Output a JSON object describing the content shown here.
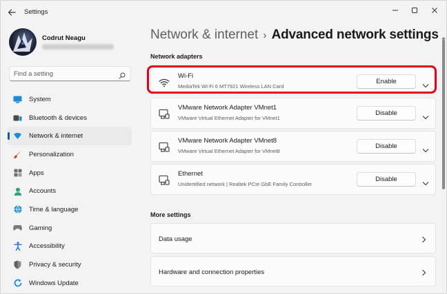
{
  "window": {
    "title": "Settings",
    "controls": [
      "minimize",
      "maximize",
      "close"
    ]
  },
  "profile": {
    "name": "Codrut Neagu"
  },
  "search": {
    "placeholder": "Find a setting"
  },
  "sidebar": {
    "items": [
      {
        "label": "System",
        "icon": "system-icon",
        "active": false
      },
      {
        "label": "Bluetooth & devices",
        "icon": "bluetooth-icon",
        "active": false
      },
      {
        "label": "Network & internet",
        "icon": "network-icon",
        "active": true
      },
      {
        "label": "Personalization",
        "icon": "brush-icon",
        "active": false
      },
      {
        "label": "Apps",
        "icon": "apps-icon",
        "active": false
      },
      {
        "label": "Accounts",
        "icon": "account-icon",
        "active": false
      },
      {
        "label": "Time & language",
        "icon": "globe-icon",
        "active": false
      },
      {
        "label": "Gaming",
        "icon": "gamepad-icon",
        "active": false
      },
      {
        "label": "Accessibility",
        "icon": "accessibility-icon",
        "active": false
      },
      {
        "label": "Privacy & security",
        "icon": "shield-icon",
        "active": false
      },
      {
        "label": "Windows Update",
        "icon": "update-icon",
        "active": false
      }
    ]
  },
  "header": {
    "parent": "Network & internet",
    "separator": "›",
    "current": "Advanced network settings"
  },
  "adapters": {
    "section_title": "Network adapters",
    "items": [
      {
        "name": "Wi-Fi",
        "description": "MediaTek Wi-Fi 6 MT7921 Wireless LAN Card",
        "action": "Enable",
        "icon": "wifi-icon",
        "highlighted": true
      },
      {
        "name": "VMware Network Adapter VMnet1",
        "description": "VMware Virtual Ethernet Adapter for VMnet1",
        "action": "Disable",
        "icon": "ethernet-icon",
        "highlighted": false
      },
      {
        "name": "VMware Network Adapter VMnet8",
        "description": "VMware Virtual Ethernet Adapter for VMnet8",
        "action": "Disable",
        "icon": "ethernet-icon",
        "highlighted": false
      },
      {
        "name": "Ethernet",
        "description": "Unidentified network | Realtek PCIe GbE Family Controller",
        "action": "Disable",
        "icon": "ethernet-icon",
        "highlighted": false
      }
    ]
  },
  "more_settings": {
    "section_title": "More settings",
    "items": [
      {
        "label": "Data usage"
      },
      {
        "label": "Hardware and connection properties"
      }
    ]
  },
  "colors": {
    "accent": "#005fb8",
    "highlight": "#e0001a",
    "background": "#f3f3f3",
    "card": "#fbfbfb"
  }
}
